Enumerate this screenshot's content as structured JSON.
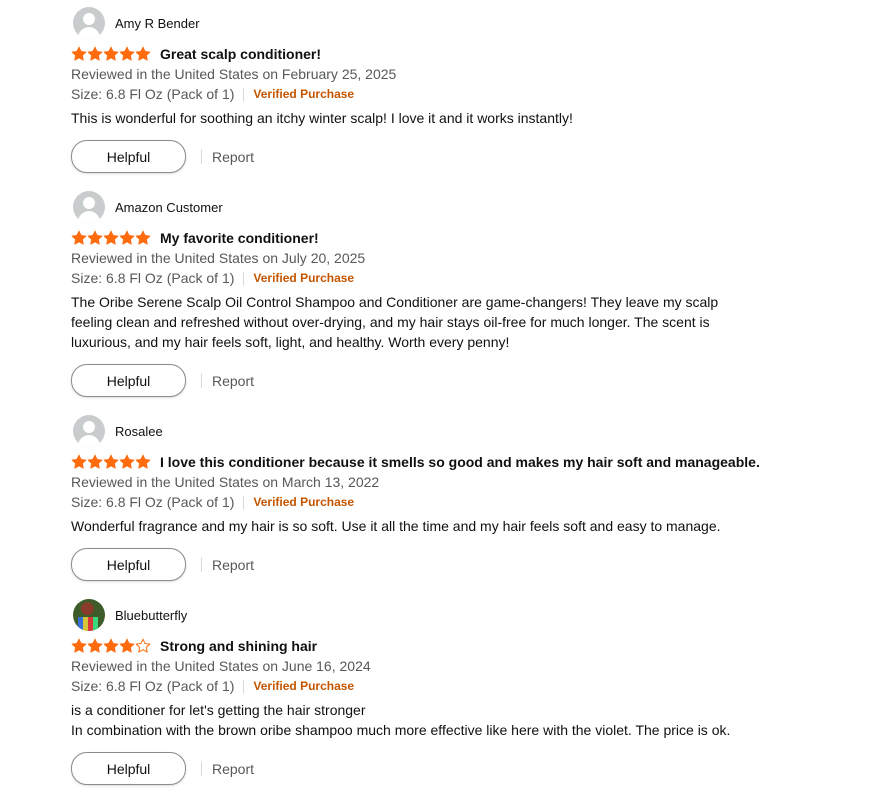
{
  "colors": {
    "star_fill": "#ff6b0d",
    "verified": "#c45500",
    "meta_text": "#565959"
  },
  "reviews": [
    {
      "name": "Amy R Bender",
      "avatar": "default-avatar",
      "rating": 5,
      "title": "Great scalp conditioner!",
      "date": "Reviewed in the United States on February 25, 2025",
      "format": "Size: 6.8 Fl Oz (Pack of 1)",
      "verified": "Verified Purchase",
      "body": "This is wonderful for soothing an itchy winter scalp! I love it and it works instantly!",
      "helpful": "Helpful",
      "report": "Report"
    },
    {
      "name": "Amazon Customer",
      "avatar": "default-avatar",
      "rating": 5,
      "title": "My favorite conditioner!",
      "date": "Reviewed in the United States on July 20, 2025",
      "format": "Size: 6.8 Fl Oz (Pack of 1)",
      "verified": "Verified Purchase",
      "body": "The Oribe Serene Scalp Oil Control Shampoo and Conditioner are game-changers! They leave my scalp feeling clean and refreshed without over-drying, and my hair stays oil-free for much longer. The scent is luxurious, and my hair feels soft, light, and healthy. Worth every penny!",
      "helpful": "Helpful",
      "report": "Report"
    },
    {
      "name": "Rosalee",
      "avatar": "default-avatar",
      "rating": 5,
      "title": "I love this conditioner because it smells so good and makes my hair soft and manageable.",
      "date": "Reviewed in the United States on March 13, 2022",
      "format": "Size: 6.8 Fl Oz (Pack of 1)",
      "verified": "Verified Purchase",
      "body": "Wonderful fragrance and my hair is so soft. Use it all the time and my hair feels soft and easy to manage.",
      "helpful": "Helpful",
      "report": "Report"
    },
    {
      "name": "Bluebutterfly",
      "avatar": "photo-avatar",
      "rating": 4,
      "title": "Strong and shining hair",
      "date": "Reviewed in the United States on June 16, 2024",
      "format": "Size: 6.8 Fl Oz (Pack of 1)",
      "verified": "Verified Purchase",
      "body_lines": [
        "is a conditioner for let's getting the hair stronger",
        "In combination with the brown oribe shampoo much more effective like here with the violet. The price is ok."
      ],
      "helpful": "Helpful",
      "report": "Report"
    }
  ]
}
